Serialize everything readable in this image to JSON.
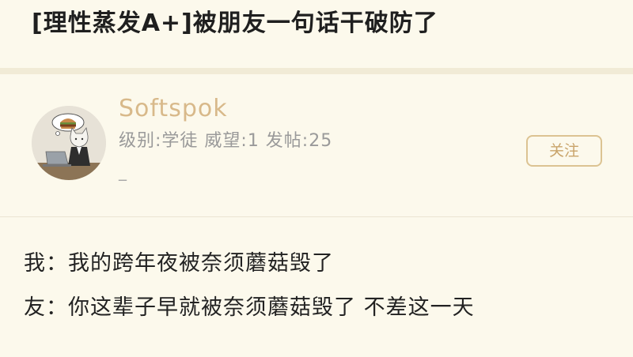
{
  "post": {
    "title": "[理性蒸发A+]被朋友一句话干破防了"
  },
  "author": {
    "name": "Softspok",
    "meta": "级别:学徒  威望:1  发帖:25",
    "signature": "_",
    "follow_label": "关注"
  },
  "content": {
    "lines": [
      "我：我的跨年夜被奈须蘑菇毁了",
      "友：你这辈子早就被奈须蘑菇毁了 不差这一天"
    ]
  },
  "colors": {
    "background": "#fbf7e8",
    "username": "#d8b98a",
    "accent_border": "#dcc392",
    "meta_text": "#9a9a9a"
  }
}
